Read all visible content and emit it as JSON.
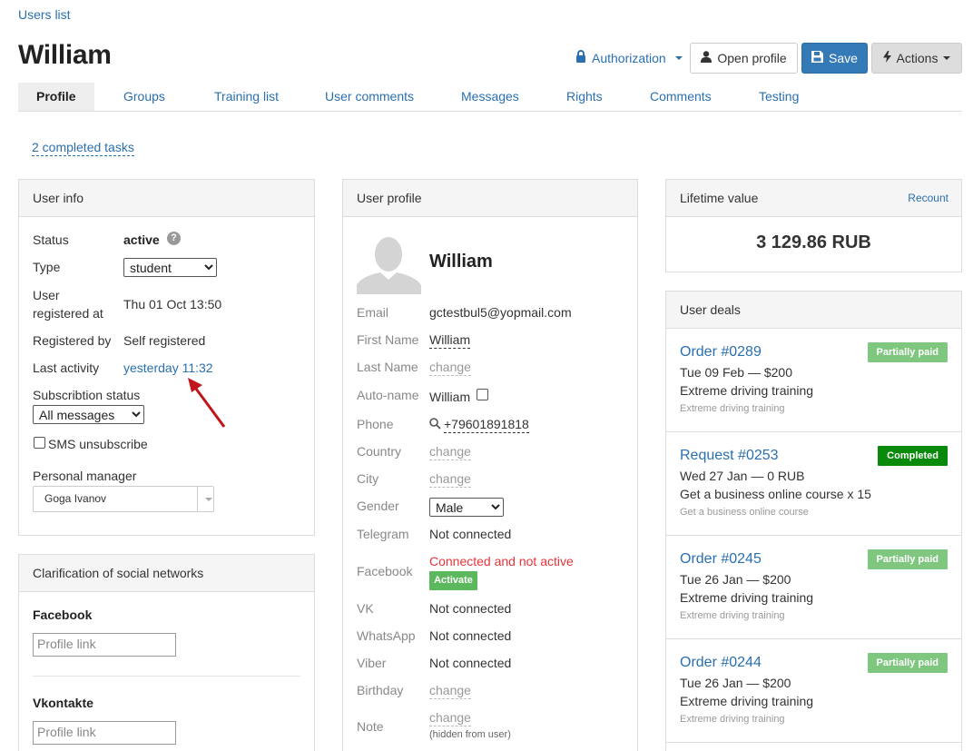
{
  "breadcrumb": "Users list",
  "page_title": "William",
  "header": {
    "authorization": "Authorization",
    "open_profile": "Open profile",
    "save": "Save",
    "actions": "Actions"
  },
  "tabs": [
    "Profile",
    "Groups",
    "Training list",
    "User comments",
    "Messages",
    "Rights",
    "Comments",
    "Testing"
  ],
  "completed_tasks": "2 completed tasks",
  "user_info": {
    "title": "User info",
    "status_label": "Status",
    "status_value": "active",
    "type_label": "Type",
    "type_value": "student",
    "registered_at_label_1": "User",
    "registered_at_label_2": "registered at",
    "registered_at_value": "Thu 01 Oct 13:50",
    "registered_by_label": "Registered by",
    "registered_by_value": "Self registered",
    "last_activity_label": "Last activity",
    "last_activity_value": "yesterday 11:32",
    "subscription_label": "Subscribtion status",
    "subscription_value": "All messages",
    "sms_label": "SMS unsubscribe",
    "manager_label": "Personal manager",
    "manager_value": "Goga Ivanov"
  },
  "social": {
    "title": "Clarification of social networks",
    "facebook_label": "Facebook",
    "facebook_placeholder": "Profile link",
    "vk_label": "Vkontakte",
    "vk_placeholder": "Profile link"
  },
  "profile": {
    "title": "User profile",
    "name": "William",
    "email_label": "Email",
    "email_value": "gctestbul5@yopmail.com",
    "first_name_label": "First Name",
    "first_name_value": "William",
    "last_name_label": "Last Name",
    "last_name_value": "change",
    "autoname_label": "Auto-name",
    "autoname_value": "William",
    "phone_label": "Phone",
    "phone_value": "+79601891818",
    "country_label": "Country",
    "country_value": "change",
    "city_label": "City",
    "city_value": "change",
    "gender_label": "Gender",
    "gender_value": "Male",
    "telegram_label": "Telegram",
    "telegram_value": "Not connected",
    "facebook_label": "Facebook",
    "facebook_value": "Connected and not active",
    "activate": "Activate",
    "vk_label": "VK",
    "vk_value": "Not connected",
    "whatsapp_label": "WhatsApp",
    "whatsapp_value": "Not connected",
    "viber_label": "Viber",
    "viber_value": "Not connected",
    "birthday_label": "Birthday",
    "birthday_value": "change",
    "note_label": "Note",
    "note_value": "change",
    "note_hint": "(hidden from user)"
  },
  "ltv": {
    "title": "Lifetime value",
    "recount": "Recount",
    "value": "3 129.86 RUB"
  },
  "deals": {
    "title": "User deals",
    "items": [
      {
        "title": "Order #0289",
        "line": "Tue 09 Feb — $200",
        "product": "Extreme driving training",
        "sub": "Extreme driving training",
        "badge": "Partially paid",
        "badge_color": "#7fc77f"
      },
      {
        "title": "Request #0253",
        "line": "Wed 27 Jan — 0 RUB",
        "product": "Get a business online course x 15",
        "sub": "Get a business online course",
        "badge": "Completed",
        "badge_color": "#0a8a0a"
      },
      {
        "title": "Order #0245",
        "line": "Tue 26 Jan — $200",
        "product": "Extreme driving training",
        "sub": "Extreme driving training",
        "badge": "Partially paid",
        "badge_color": "#7fc77f"
      },
      {
        "title": "Order #0244",
        "line": "Tue 26 Jan — $200",
        "product": "Extreme driving training",
        "sub": "Extreme driving training",
        "badge": "Partially paid",
        "badge_color": "#7fc77f"
      }
    ]
  },
  "colors": {
    "link": "#2a6fb0",
    "primary": "#337ab7",
    "danger": "#e8333a",
    "success": "#5cb85c"
  }
}
